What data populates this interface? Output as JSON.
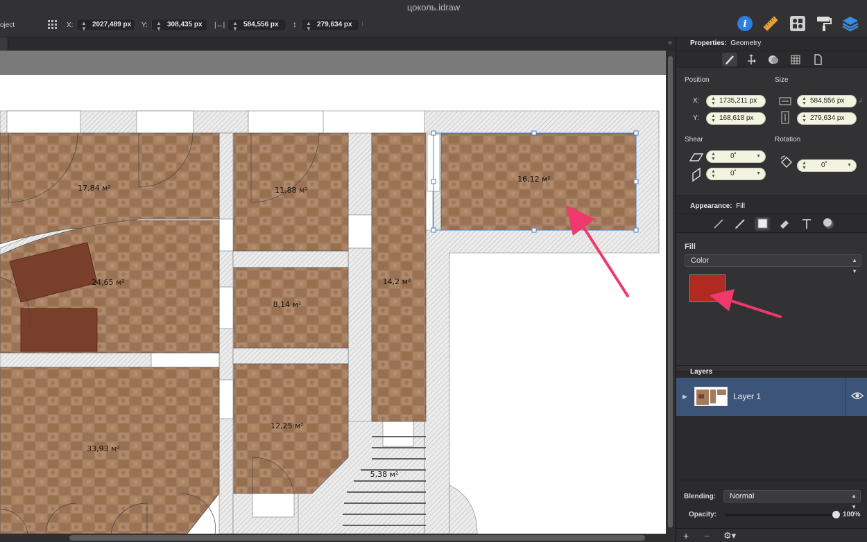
{
  "window": {
    "title": "цоколь.idraw"
  },
  "toolbar": {
    "project_label": "oject",
    "x_label": "X:",
    "x_value": "2027,489 px",
    "y_label": "Y:",
    "y_value": "308,435 px",
    "w_value": "584,556 px",
    "h_value": "279,634 px",
    "icons": [
      "info-icon",
      "ruler-icon",
      "grid-icon",
      "paint-roller-icon",
      "layers-icon"
    ]
  },
  "properties": {
    "header_label": "Properties:",
    "header_value": "Geometry",
    "position_label": "Position",
    "size_label": "Size",
    "x_label": "X:",
    "x_value": "1735,211 px",
    "y_label": "Y:",
    "y_value": "168,618 px",
    "width_value": "584,556 px",
    "height_value": "279,634 px",
    "shear_label": "Shear",
    "rotation_label": "Rotation",
    "shear_h": "0˚",
    "shear_v": "0˚",
    "rotation_value": "0˚"
  },
  "appearance": {
    "header_label": "Appearance:",
    "header_value": "Fill",
    "fill_label": "Fill",
    "fill_type": "Color",
    "fill_color": "#b02a22"
  },
  "layers": {
    "header": "Layers",
    "items": [
      {
        "name": "Layer 1",
        "visible": true
      }
    ]
  },
  "blending": {
    "blending_label": "Blending:",
    "blending_value": "Normal",
    "opacity_label": "Opacity:",
    "opacity_value": "100%",
    "opacity": 1.0
  },
  "canvas": {
    "rooms": [
      "17,84 м²",
      "11,88 м²",
      "16,12 м²",
      "24,65 м²",
      "14,2 м²",
      "8,14 м²",
      "33,93 м²",
      "12,25 м²",
      "5,38 м²"
    ]
  },
  "colors": {
    "accent_arrow": "#f0386b",
    "selection": "#4a7ec8",
    "floor": "#a0775a"
  }
}
